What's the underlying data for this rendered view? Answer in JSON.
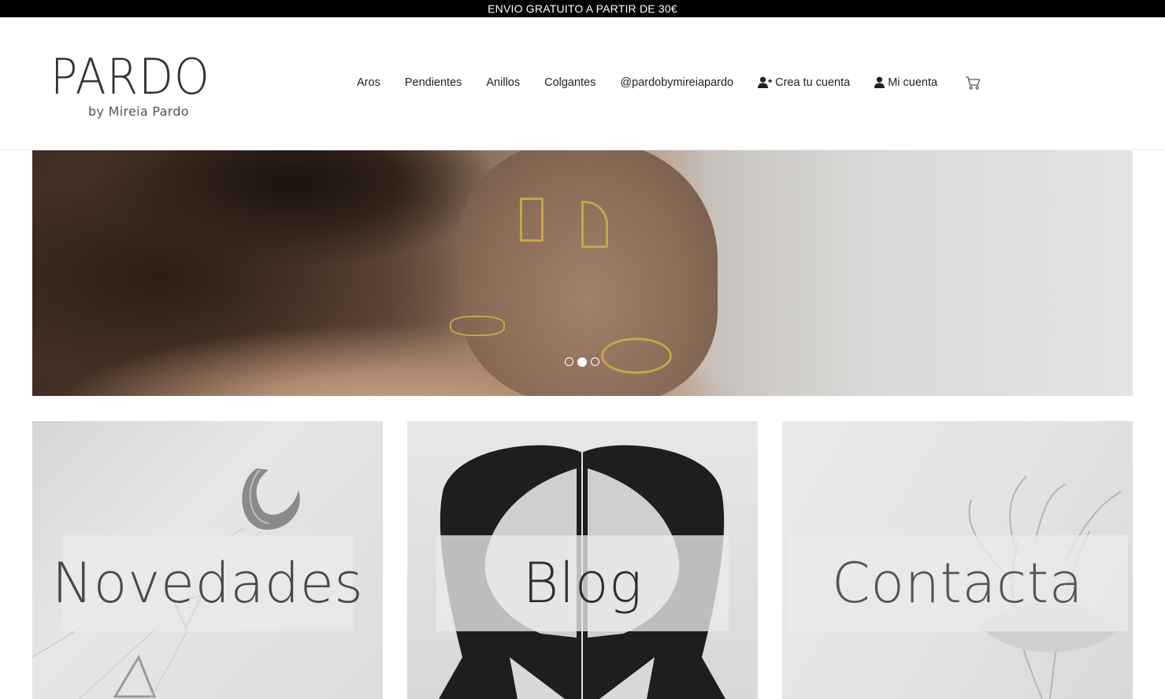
{
  "announcement": {
    "text": "ENVIO GRATUITO A PARTIR DE 30€"
  },
  "logo": {
    "name": "PARDO",
    "tagline": "by Mireia Pardo"
  },
  "nav": {
    "items": [
      {
        "label": "Aros"
      },
      {
        "label": "Pendientes"
      },
      {
        "label": "Anillos"
      },
      {
        "label": "Colgantes"
      },
      {
        "label": "@pardobymireiapardo"
      },
      {
        "label": "Crea tu cuenta",
        "icon": "user-plus-icon"
      },
      {
        "label": "Mi cuenta",
        "icon": "user-icon"
      }
    ],
    "cart_icon": "cart-icon"
  },
  "hero": {
    "slides_total": 3,
    "active_slide": 2
  },
  "tiles": [
    {
      "label": "Novedades"
    },
    {
      "label": "Blog"
    },
    {
      "label": "Contacta"
    }
  ],
  "colors": {
    "topbar_bg": "#000000",
    "text": "#222222",
    "gold": "#c9a44a"
  }
}
